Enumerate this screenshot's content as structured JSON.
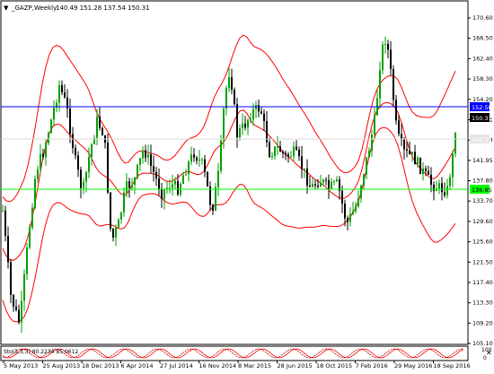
{
  "window": {
    "symbol": "_GAZP,Weekly",
    "ohlc": "140.49 151.28 137.54 150.31",
    "indicator_label": "Sto(3,3,3) 80.2234 85.0612",
    "close_icon": "close-x-icon",
    "prices": {
      "upper_hline": "152.56",
      "current": "150.31",
      "mid_hline": "146.14",
      "lower_hline": "136.85"
    }
  },
  "colors": {
    "background": "#ffffff",
    "grid": "#e6e6e6",
    "candle_up": "#00a000",
    "candle_down": "#000000",
    "bands": "#ff0000",
    "hline_upper": "#0000ff",
    "hline_mid": "#d9d9d9",
    "hline_lower": "#00ff00",
    "stoch": "#ff0000"
  },
  "chart_data": {
    "type": "candlestick",
    "y_ticks": [
      "170.60",
      "166.50",
      "162.40",
      "158.30",
      "154.20",
      "150.31",
      "146.14",
      "141.95",
      "137.80",
      "133.70",
      "129.60",
      "125.60",
      "121.50",
      "117.40",
      "113.30",
      "109.20",
      "105.10"
    ],
    "x_ticks": [
      "5 May 2013",
      "25 Aug 2013",
      "18 Dec 2013",
      "6 Apr 2014",
      "27 Jul 2014",
      "16 Nov 2014",
      "8 Mar 2015",
      "28 Jun 2015",
      "18 Oct 2015",
      "7 Feb 2016",
      "29 May 2016",
      "18 Sep 2016"
    ],
    "ylim": [
      105.1,
      172.5
    ],
    "horizontal_levels": [
      152.56,
      146.14,
      136.85
    ],
    "last_close": 150.31
  }
}
